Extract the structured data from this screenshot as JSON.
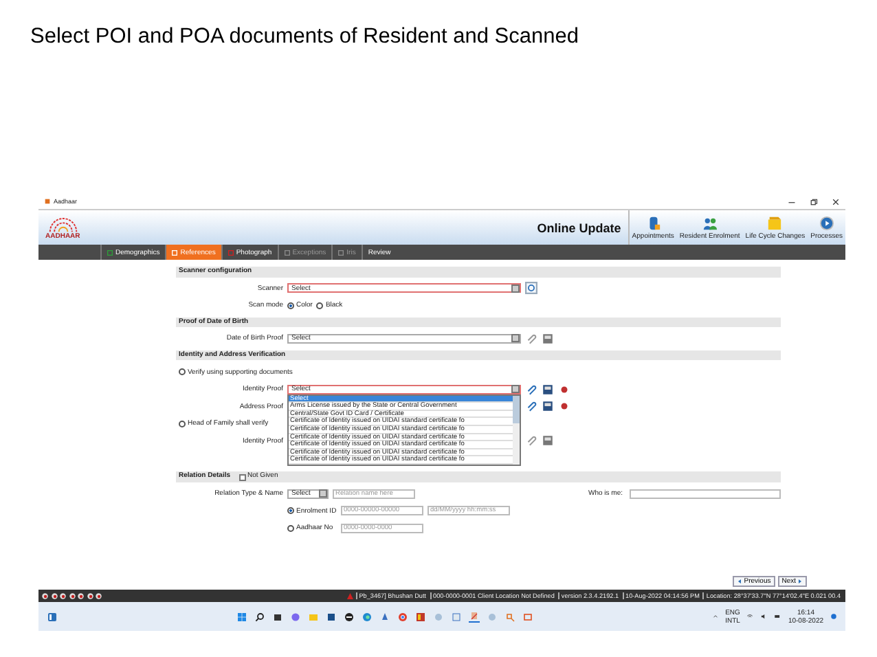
{
  "slide_title": "Select POI and POA documents of Resident and Scanned",
  "window": {
    "title": "Aadhaar"
  },
  "header": {
    "logo_text": "AADHAAR",
    "title": "Online Update",
    "tools": [
      {
        "label": "Appointments",
        "kind": "database"
      },
      {
        "label": "Resident Enrolment",
        "kind": "people"
      },
      {
        "label": "Life Cycle Changes",
        "kind": "folder"
      },
      {
        "label": "Processes",
        "kind": "process"
      }
    ]
  },
  "steps": [
    {
      "label": "Demographics",
      "selected": false,
      "disabled": false,
      "color": "#2e9e3a"
    },
    {
      "label": "References",
      "selected": true,
      "disabled": false,
      "color": "#ffffff"
    },
    {
      "label": "Photograph",
      "selected": false,
      "disabled": false,
      "color": "#d02020"
    },
    {
      "label": "Exceptions",
      "selected": false,
      "disabled": true,
      "color": "#8a8a8a"
    },
    {
      "label": "Iris",
      "selected": false,
      "disabled": true,
      "color": "#8a8a8a"
    },
    {
      "label": "Review",
      "selected": false,
      "disabled": false
    }
  ],
  "scanner_configuration": {
    "heading": "Scanner configuration",
    "scanner_label": "Scanner",
    "scanner_value": "Select",
    "scan_mode_label": "Scan mode",
    "modes": [
      {
        "label": "Color",
        "selected": true
      },
      {
        "label": "Black",
        "selected": false
      }
    ]
  },
  "proof_of_birth": {
    "heading": "Proof of Date of Birth",
    "label": "Date of Birth Proof",
    "value": "Select",
    "enabled": false
  },
  "identity_address": {
    "heading": "Identity and Address Verification",
    "verify_option": {
      "label": "Verify using supporting documents",
      "selected": false
    },
    "identity_proof": {
      "label": "Identity Proof",
      "value": "Select",
      "enabled": true
    },
    "dropdown_options": [
      {
        "label": "Select",
        "selected": true
      },
      {
        "label": "Arms License issued by the State or Central Government",
        "selected": false
      },
      {
        "label": "Central/State Govt ID Card / Certificate",
        "selected": false
      },
      {
        "label": "Certificate of Identity issued on UIDAI standard certificate fo",
        "selected": false
      },
      {
        "label": "Certificate of Identity issued on UIDAI standard certificate fo",
        "selected": false
      },
      {
        "label": "Certificate of Identity issued on UIDAI standard certificate fo",
        "selected": false
      },
      {
        "label": "Certificate of Identity issued on UIDAI standard certificate fo",
        "selected": false
      },
      {
        "label": "Certificate of Identity issued on UIDAI standard certificate fo",
        "selected": false
      },
      {
        "label": "Certificate of Identity issued on UIDAI standard certificate fo",
        "selected": false
      }
    ],
    "address_proof": {
      "label": "Address Proof",
      "enabled": true
    },
    "hof_option": {
      "label": "Head of Family shall verify",
      "selected": false
    },
    "hof_identity_proof": {
      "label": "Identity Proof",
      "enabled": false
    }
  },
  "relation_details": {
    "heading": "Relation Details",
    "not_given": {
      "label": "Not Given",
      "checked": false
    },
    "type_label": "Relation Type & Name",
    "type_value": "Select",
    "name_placeholder": "Relation name here",
    "options": [
      {
        "label": "Enrolment ID",
        "selected": true,
        "placeholder": "0000-00000-00000",
        "second_placeholder": "dd/MM/yyyy hh:mm:ss"
      },
      {
        "label": "Aadhaar No",
        "selected": false,
        "placeholder": "0000-0000-0000"
      }
    ],
    "who_label": "Who is me:"
  },
  "nav_buttons": [
    {
      "label": "Previous",
      "kind": "previous"
    },
    {
      "label": "Next",
      "kind": "next"
    }
  ],
  "status_bar": {
    "segments": [
      "Pb_3467] Bhushan Dutt",
      "000-0000-0001 Client Location Not Defined",
      "version 2.3.4.2192.1",
      "10-Aug-2022 04:14:56 PM",
      "Location: 28°37'33.7\"N 77°14'02.4\"E 0.021 00.4"
    ]
  },
  "taskbar": {
    "language": "ENG",
    "layout": "INTL",
    "time": "16:14",
    "date": "10-08-2022"
  }
}
